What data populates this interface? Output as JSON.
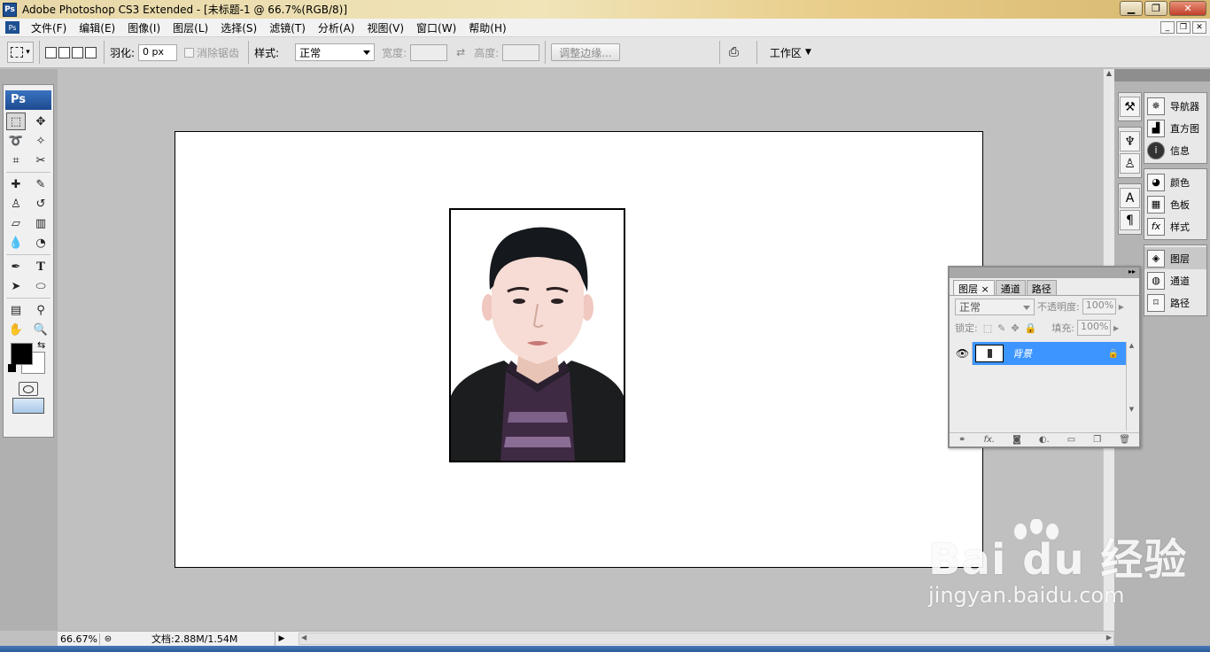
{
  "window": {
    "title": "Adobe Photoshop CS3 Extended - [未标题-1 @ 66.7%(RGB/8)]",
    "app_icon": "Ps"
  },
  "menu": [
    "文件(F)",
    "编辑(E)",
    "图像(I)",
    "图层(L)",
    "选择(S)",
    "滤镜(T)",
    "分析(A)",
    "视图(V)",
    "窗口(W)",
    "帮助(H)"
  ],
  "options": {
    "feather_label": "羽化:",
    "feather_value": "0 px",
    "antialias_label": "消除锯齿",
    "style_label": "样式:",
    "style_value": "正常",
    "width_label": "宽度:",
    "height_label": "高度:",
    "refine_edge": "调整边缘...",
    "workspace": "工作区"
  },
  "toolbox": {
    "header": "Ps"
  },
  "status": {
    "zoom": "66.67%",
    "doc_info": "文档:2.88M/1.54M"
  },
  "dock": {
    "group1": [
      "导航器",
      "直方图",
      "信息"
    ],
    "group2": [
      "颜色",
      "色板",
      "样式"
    ],
    "group3": [
      "图层",
      "通道",
      "路径"
    ]
  },
  "layers_panel": {
    "tabs": [
      "图层",
      "通道",
      "路径"
    ],
    "blend_mode": "正常",
    "opacity_label": "不透明度:",
    "opacity_value": "100%",
    "lock_label": "锁定:",
    "fill_label": "填充:",
    "fill_value": "100%",
    "layer_name": "背景"
  },
  "watermark": {
    "main": "Bai du 经验",
    "sub": "jingyan.baidu.com"
  }
}
